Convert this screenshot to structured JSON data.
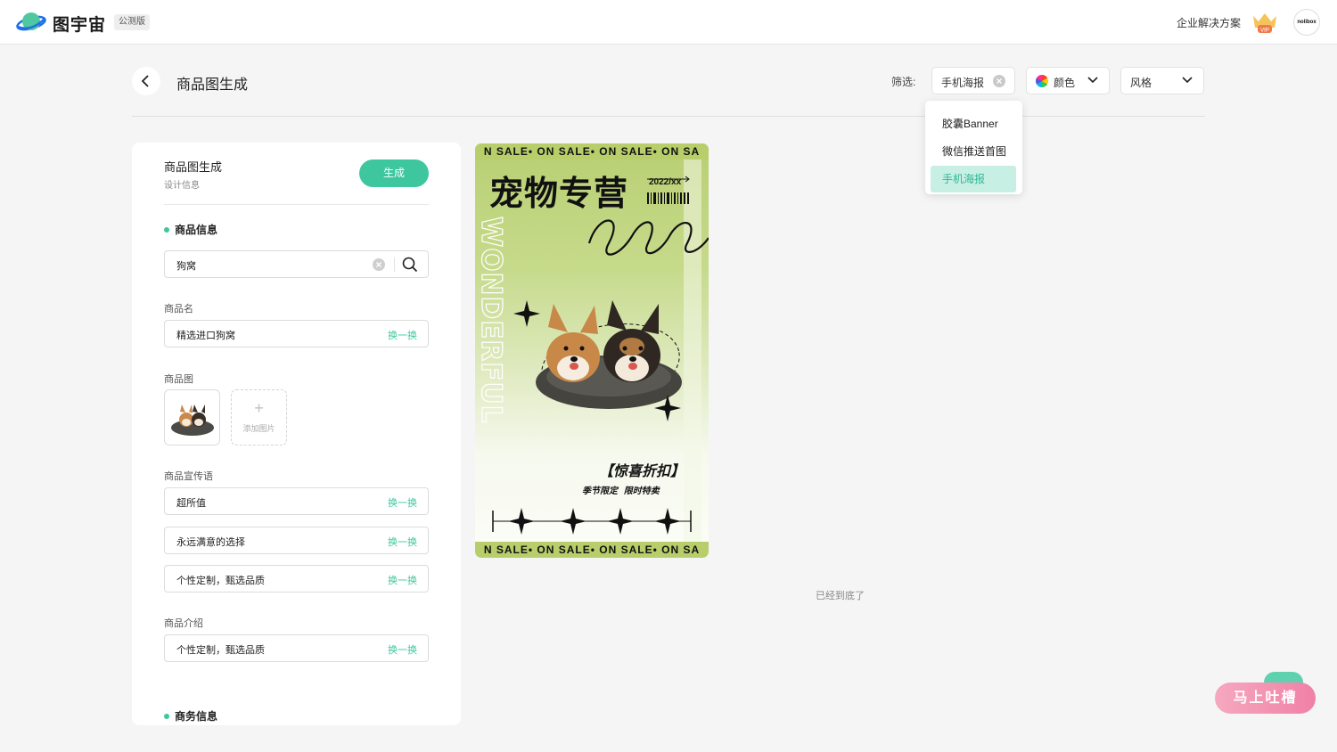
{
  "header": {
    "brand": "图宇宙",
    "beta_badge": "公测版",
    "enterprise_link": "企业解决方案",
    "vip_badge": "VIP",
    "avatar_text": "nolibox",
    "logo_icon": "planet-logo-icon"
  },
  "page": {
    "title": "商品图生成",
    "filter_label": "筛选:",
    "filters": {
      "type": "手机海报",
      "color": "颜色",
      "style": "风格"
    },
    "dropdown_options": [
      "胶囊Banner",
      "微信推送首图",
      "手机海报"
    ],
    "dropdown_selected": "手机海报",
    "end_text": "已经到底了"
  },
  "panel": {
    "title": "商品图生成",
    "subtitle": "设计信息",
    "generate_button": "生成",
    "product_info_section": "商品信息",
    "search_value": "狗窝",
    "product_name_label": "商品名",
    "product_name": "精选进口狗窝",
    "swap_label": "换一换",
    "product_image_label": "商品图",
    "add_image": "添加图片",
    "slogan_label": "商品宣传语",
    "slogans": [
      "超所值",
      "永远满意的选择",
      "个性定制，甄选品质"
    ],
    "intro_label": "商品介绍",
    "intro": "个性定制，甄选品质",
    "business_section": "商务信息"
  },
  "poster": {
    "sale_strip": "N SALE• ON SALE• ON SALE• ON SA",
    "title": "宠物专营",
    "date": "2022/xx",
    "vertical_text": "WONDERFUL",
    "tag": "【惊喜折扣】",
    "subtitle": "季节限定 限时特卖"
  },
  "feedback": {
    "button": "马上吐槽"
  },
  "colors": {
    "accent": "#3ec79f",
    "poster_green": "#b7ce6b",
    "feedback_pink": "#f081a6"
  }
}
